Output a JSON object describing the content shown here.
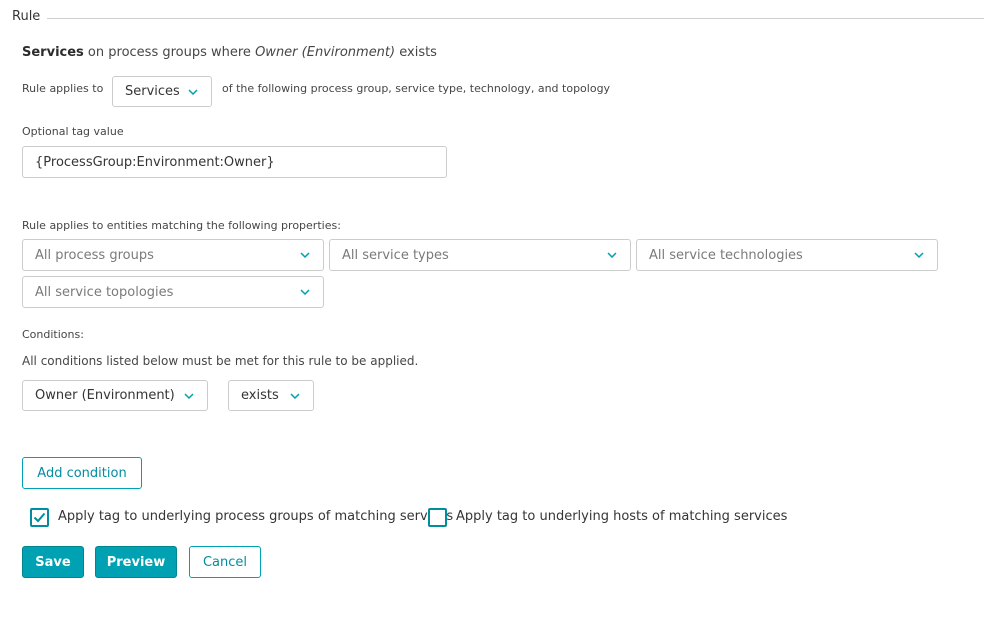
{
  "section": {
    "title": "Rule"
  },
  "summary": {
    "bold": "Services",
    "pre": " on process groups where ",
    "italic": "Owner (Environment)",
    "post": " exists"
  },
  "applies": {
    "label": "Rule applies to",
    "selected": "Services",
    "suffix": "of the following process group, service type, technology, and topology"
  },
  "tag": {
    "label": "Optional tag value",
    "value": "{ProcessGroup:Environment:Owner}"
  },
  "properties": {
    "label": "Rule applies to entities matching the following properties:",
    "process_groups": "All process groups",
    "service_types": "All service types",
    "service_technologies": "All service technologies",
    "service_topologies": "All service topologies"
  },
  "conditions": {
    "label": "Conditions:",
    "note": "All conditions listed below must be met for this rule to be applied.",
    "property": "Owner (Environment)",
    "operator": "exists",
    "add_label": "Add condition"
  },
  "options": {
    "pg_label": "Apply tag to underlying process groups of matching services",
    "pg_checked": true,
    "hosts_label": "Apply tag to underlying hosts of matching services",
    "hosts_checked": false
  },
  "actions": {
    "save": "Save",
    "preview": "Preview",
    "cancel": "Cancel"
  },
  "colors": {
    "accent": "#00a1b2",
    "accent_dark": "#008da0",
    "border": "#cccccc"
  },
  "icons": {
    "chevron": "chevron-down-icon",
    "check": "check-icon"
  }
}
